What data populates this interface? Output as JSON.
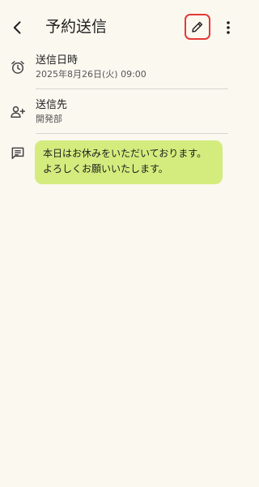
{
  "app_bar": {
    "title": "予約送信",
    "back_icon": "chevron-left-icon",
    "edit_icon": "pencil-icon",
    "more_icon": "more-vertical-icon",
    "highlight_color": "#e53935"
  },
  "details": {
    "send_time": {
      "icon": "alarm-clock-icon",
      "label": "送信日時",
      "value": "2025年8月26日(火) 09:00"
    },
    "recipient": {
      "icon": "person-add-icon",
      "label": "送信先",
      "value": "開発部"
    },
    "message": {
      "icon": "message-icon",
      "lines": [
        "本日はお休みをいただいております。",
        "よろしくお願いいたします。"
      ],
      "bubble_color": "#d4ec7e"
    }
  }
}
